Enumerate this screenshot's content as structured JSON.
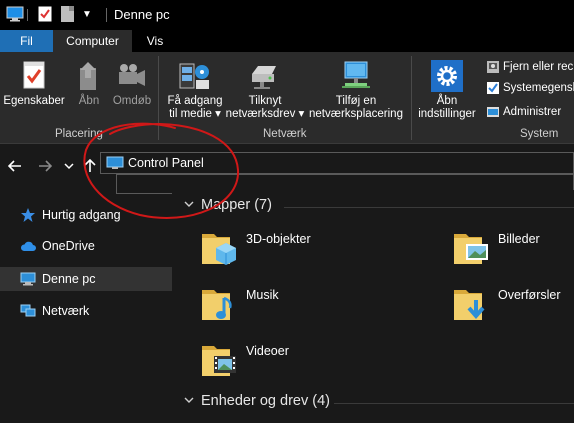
{
  "window": {
    "title": "Denne pc"
  },
  "tabs": [
    {
      "label": "Fil"
    },
    {
      "label": "Computer"
    },
    {
      "label": "Vis"
    }
  ],
  "ribbon": {
    "placering": {
      "label": "Placering",
      "buttons": [
        {
          "label": "Egenskaber",
          "icon": "properties-icon",
          "enabled": true
        },
        {
          "label": "Åbn",
          "icon": "open-icon",
          "enabled": false
        },
        {
          "label": "Omdøb",
          "icon": "rename-icon",
          "enabled": false
        }
      ]
    },
    "netvaerk": {
      "label": "Netværk",
      "buttons": [
        {
          "line1": "Få adgang",
          "line2": "til medie",
          "icon": "media-icon"
        },
        {
          "line1": "Tilknyt",
          "line2": "netværksdrev",
          "icon": "map-drive-icon"
        },
        {
          "line1": "Tilføj en",
          "line2": "netværksplacering",
          "icon": "network-location-icon"
        }
      ]
    },
    "system": {
      "label": "System",
      "open_settings": {
        "line1": "Åbn",
        "line2": "indstillinger",
        "icon": "settings-gear-icon"
      },
      "small_buttons": [
        {
          "label": "Fjern eller rec",
          "icon": "uninstall-icon"
        },
        {
          "label": "Systemegensk",
          "icon": "system-properties-icon"
        },
        {
          "label": "Administrer",
          "icon": "manage-icon"
        }
      ]
    }
  },
  "address_bar": {
    "value": "Control Panel",
    "icon": "control-panel-icon"
  },
  "sidebar": {
    "items": [
      {
        "label": "Hurtig adgang",
        "icon": "star-icon"
      },
      {
        "label": "OneDrive",
        "icon": "cloud-icon"
      },
      {
        "label": "Denne pc",
        "icon": "pc-icon",
        "selected": true
      },
      {
        "label": "Netværk",
        "icon": "network-icon"
      }
    ]
  },
  "content": {
    "folders_header": "Mapper (7)",
    "folders": [
      {
        "name": "3D-objekter",
        "icon": "3d-objects-folder-icon"
      },
      {
        "name": "Billeder",
        "icon": "pictures-folder-icon"
      },
      {
        "name": "Musik",
        "icon": "music-folder-icon"
      },
      {
        "name": "Overførsler",
        "icon": "downloads-folder-icon"
      },
      {
        "name": "Videoer",
        "icon": "videos-folder-icon"
      }
    ],
    "drives_header": "Enheder og drev (4)"
  },
  "colors": {
    "accent": "#1f6fb5",
    "annotation": "#d01818",
    "folder": "#e8c25a"
  }
}
